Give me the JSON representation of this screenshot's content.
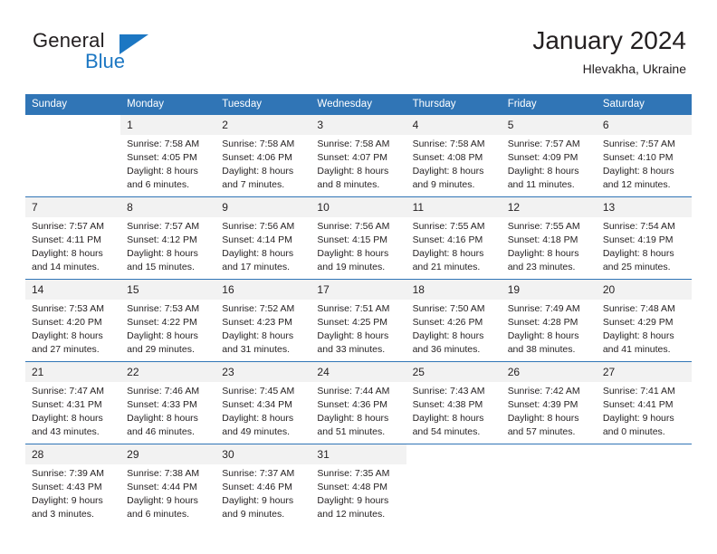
{
  "brand": {
    "name_part1": "General",
    "name_part2": "Blue",
    "flag_icon": "brand-triangle-icon"
  },
  "header": {
    "title": "January 2024",
    "subtitle": "Hlevakha, Ukraine"
  },
  "calendar": {
    "weekday_headers": [
      "Sunday",
      "Monday",
      "Tuesday",
      "Wednesday",
      "Thursday",
      "Friday",
      "Saturday"
    ],
    "accent_color": "#3075b6",
    "daynum_band_color": "#f2f2f2",
    "weeks": [
      [
        {
          "day": "",
          "sunrise": "",
          "sunset": "",
          "daylight1": "",
          "daylight2": ""
        },
        {
          "day": "1",
          "sunrise": "Sunrise: 7:58 AM",
          "sunset": "Sunset: 4:05 PM",
          "daylight1": "Daylight: 8 hours",
          "daylight2": "and 6 minutes."
        },
        {
          "day": "2",
          "sunrise": "Sunrise: 7:58 AM",
          "sunset": "Sunset: 4:06 PM",
          "daylight1": "Daylight: 8 hours",
          "daylight2": "and 7 minutes."
        },
        {
          "day": "3",
          "sunrise": "Sunrise: 7:58 AM",
          "sunset": "Sunset: 4:07 PM",
          "daylight1": "Daylight: 8 hours",
          "daylight2": "and 8 minutes."
        },
        {
          "day": "4",
          "sunrise": "Sunrise: 7:58 AM",
          "sunset": "Sunset: 4:08 PM",
          "daylight1": "Daylight: 8 hours",
          "daylight2": "and 9 minutes."
        },
        {
          "day": "5",
          "sunrise": "Sunrise: 7:57 AM",
          "sunset": "Sunset: 4:09 PM",
          "daylight1": "Daylight: 8 hours",
          "daylight2": "and 11 minutes."
        },
        {
          "day": "6",
          "sunrise": "Sunrise: 7:57 AM",
          "sunset": "Sunset: 4:10 PM",
          "daylight1": "Daylight: 8 hours",
          "daylight2": "and 12 minutes."
        }
      ],
      [
        {
          "day": "7",
          "sunrise": "Sunrise: 7:57 AM",
          "sunset": "Sunset: 4:11 PM",
          "daylight1": "Daylight: 8 hours",
          "daylight2": "and 14 minutes."
        },
        {
          "day": "8",
          "sunrise": "Sunrise: 7:57 AM",
          "sunset": "Sunset: 4:12 PM",
          "daylight1": "Daylight: 8 hours",
          "daylight2": "and 15 minutes."
        },
        {
          "day": "9",
          "sunrise": "Sunrise: 7:56 AM",
          "sunset": "Sunset: 4:14 PM",
          "daylight1": "Daylight: 8 hours",
          "daylight2": "and 17 minutes."
        },
        {
          "day": "10",
          "sunrise": "Sunrise: 7:56 AM",
          "sunset": "Sunset: 4:15 PM",
          "daylight1": "Daylight: 8 hours",
          "daylight2": "and 19 minutes."
        },
        {
          "day": "11",
          "sunrise": "Sunrise: 7:55 AM",
          "sunset": "Sunset: 4:16 PM",
          "daylight1": "Daylight: 8 hours",
          "daylight2": "and 21 minutes."
        },
        {
          "day": "12",
          "sunrise": "Sunrise: 7:55 AM",
          "sunset": "Sunset: 4:18 PM",
          "daylight1": "Daylight: 8 hours",
          "daylight2": "and 23 minutes."
        },
        {
          "day": "13",
          "sunrise": "Sunrise: 7:54 AM",
          "sunset": "Sunset: 4:19 PM",
          "daylight1": "Daylight: 8 hours",
          "daylight2": "and 25 minutes."
        }
      ],
      [
        {
          "day": "14",
          "sunrise": "Sunrise: 7:53 AM",
          "sunset": "Sunset: 4:20 PM",
          "daylight1": "Daylight: 8 hours",
          "daylight2": "and 27 minutes."
        },
        {
          "day": "15",
          "sunrise": "Sunrise: 7:53 AM",
          "sunset": "Sunset: 4:22 PM",
          "daylight1": "Daylight: 8 hours",
          "daylight2": "and 29 minutes."
        },
        {
          "day": "16",
          "sunrise": "Sunrise: 7:52 AM",
          "sunset": "Sunset: 4:23 PM",
          "daylight1": "Daylight: 8 hours",
          "daylight2": "and 31 minutes."
        },
        {
          "day": "17",
          "sunrise": "Sunrise: 7:51 AM",
          "sunset": "Sunset: 4:25 PM",
          "daylight1": "Daylight: 8 hours",
          "daylight2": "and 33 minutes."
        },
        {
          "day": "18",
          "sunrise": "Sunrise: 7:50 AM",
          "sunset": "Sunset: 4:26 PM",
          "daylight1": "Daylight: 8 hours",
          "daylight2": "and 36 minutes."
        },
        {
          "day": "19",
          "sunrise": "Sunrise: 7:49 AM",
          "sunset": "Sunset: 4:28 PM",
          "daylight1": "Daylight: 8 hours",
          "daylight2": "and 38 minutes."
        },
        {
          "day": "20",
          "sunrise": "Sunrise: 7:48 AM",
          "sunset": "Sunset: 4:29 PM",
          "daylight1": "Daylight: 8 hours",
          "daylight2": "and 41 minutes."
        }
      ],
      [
        {
          "day": "21",
          "sunrise": "Sunrise: 7:47 AM",
          "sunset": "Sunset: 4:31 PM",
          "daylight1": "Daylight: 8 hours",
          "daylight2": "and 43 minutes."
        },
        {
          "day": "22",
          "sunrise": "Sunrise: 7:46 AM",
          "sunset": "Sunset: 4:33 PM",
          "daylight1": "Daylight: 8 hours",
          "daylight2": "and 46 minutes."
        },
        {
          "day": "23",
          "sunrise": "Sunrise: 7:45 AM",
          "sunset": "Sunset: 4:34 PM",
          "daylight1": "Daylight: 8 hours",
          "daylight2": "and 49 minutes."
        },
        {
          "day": "24",
          "sunrise": "Sunrise: 7:44 AM",
          "sunset": "Sunset: 4:36 PM",
          "daylight1": "Daylight: 8 hours",
          "daylight2": "and 51 minutes."
        },
        {
          "day": "25",
          "sunrise": "Sunrise: 7:43 AM",
          "sunset": "Sunset: 4:38 PM",
          "daylight1": "Daylight: 8 hours",
          "daylight2": "and 54 minutes."
        },
        {
          "day": "26",
          "sunrise": "Sunrise: 7:42 AM",
          "sunset": "Sunset: 4:39 PM",
          "daylight1": "Daylight: 8 hours",
          "daylight2": "and 57 minutes."
        },
        {
          "day": "27",
          "sunrise": "Sunrise: 7:41 AM",
          "sunset": "Sunset: 4:41 PM",
          "daylight1": "Daylight: 9 hours",
          "daylight2": "and 0 minutes."
        }
      ],
      [
        {
          "day": "28",
          "sunrise": "Sunrise: 7:39 AM",
          "sunset": "Sunset: 4:43 PM",
          "daylight1": "Daylight: 9 hours",
          "daylight2": "and 3 minutes."
        },
        {
          "day": "29",
          "sunrise": "Sunrise: 7:38 AM",
          "sunset": "Sunset: 4:44 PM",
          "daylight1": "Daylight: 9 hours",
          "daylight2": "and 6 minutes."
        },
        {
          "day": "30",
          "sunrise": "Sunrise: 7:37 AM",
          "sunset": "Sunset: 4:46 PM",
          "daylight1": "Daylight: 9 hours",
          "daylight2": "and 9 minutes."
        },
        {
          "day": "31",
          "sunrise": "Sunrise: 7:35 AM",
          "sunset": "Sunset: 4:48 PM",
          "daylight1": "Daylight: 9 hours",
          "daylight2": "and 12 minutes."
        },
        {
          "day": "",
          "sunrise": "",
          "sunset": "",
          "daylight1": "",
          "daylight2": ""
        },
        {
          "day": "",
          "sunrise": "",
          "sunset": "",
          "daylight1": "",
          "daylight2": ""
        },
        {
          "day": "",
          "sunrise": "",
          "sunset": "",
          "daylight1": "",
          "daylight2": ""
        }
      ]
    ]
  }
}
